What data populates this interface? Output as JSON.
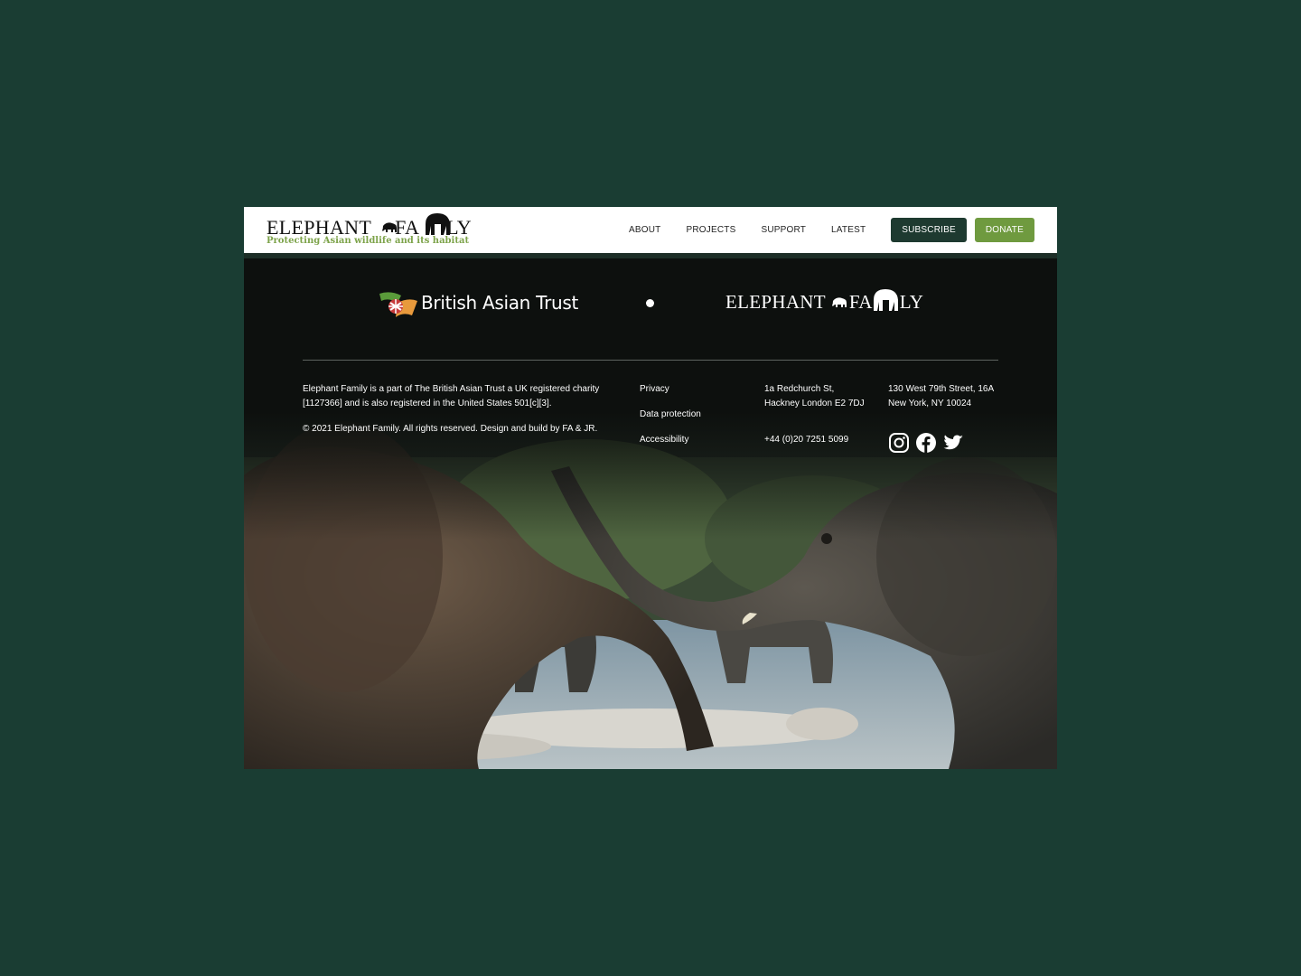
{
  "header": {
    "logo_text": [
      "ELEPHANT",
      "FA",
      "LY"
    ],
    "tagline": "Protecting Asian wildlife and its habitat",
    "nav": [
      "ABOUT",
      "PROJECTS",
      "SUPPORT",
      "LATEST"
    ],
    "subscribe_label": "SUBSCRIBE",
    "donate_label": "DONATE"
  },
  "footer": {
    "partner_logo_text": "British Asian Trust",
    "about_text": "Elephant Family is a part of The British Asian Trust a UK registered charity [1127366] and is also registered in the United States 501[c][3].",
    "copyright": "© 2021 Elephant Family. All rights reserved. Design and build by FA & JR.",
    "links": [
      "Privacy",
      "Data protection",
      "Accessibility"
    ],
    "uk_address": [
      "1a Redchurch St,",
      "Hackney London E2 7DJ"
    ],
    "phone": "+44 (0)20 7251 5099",
    "us_address": [
      "130 West 79th Street, 16A",
      "New York, NY 10024"
    ],
    "social": [
      "instagram-icon",
      "facebook-icon",
      "twitter-icon"
    ]
  },
  "colors": {
    "page_background": "#1a3d33",
    "subscribe_button": "#1e3a30",
    "donate_button": "#6f9a3f",
    "tagline": "#7da34a"
  }
}
